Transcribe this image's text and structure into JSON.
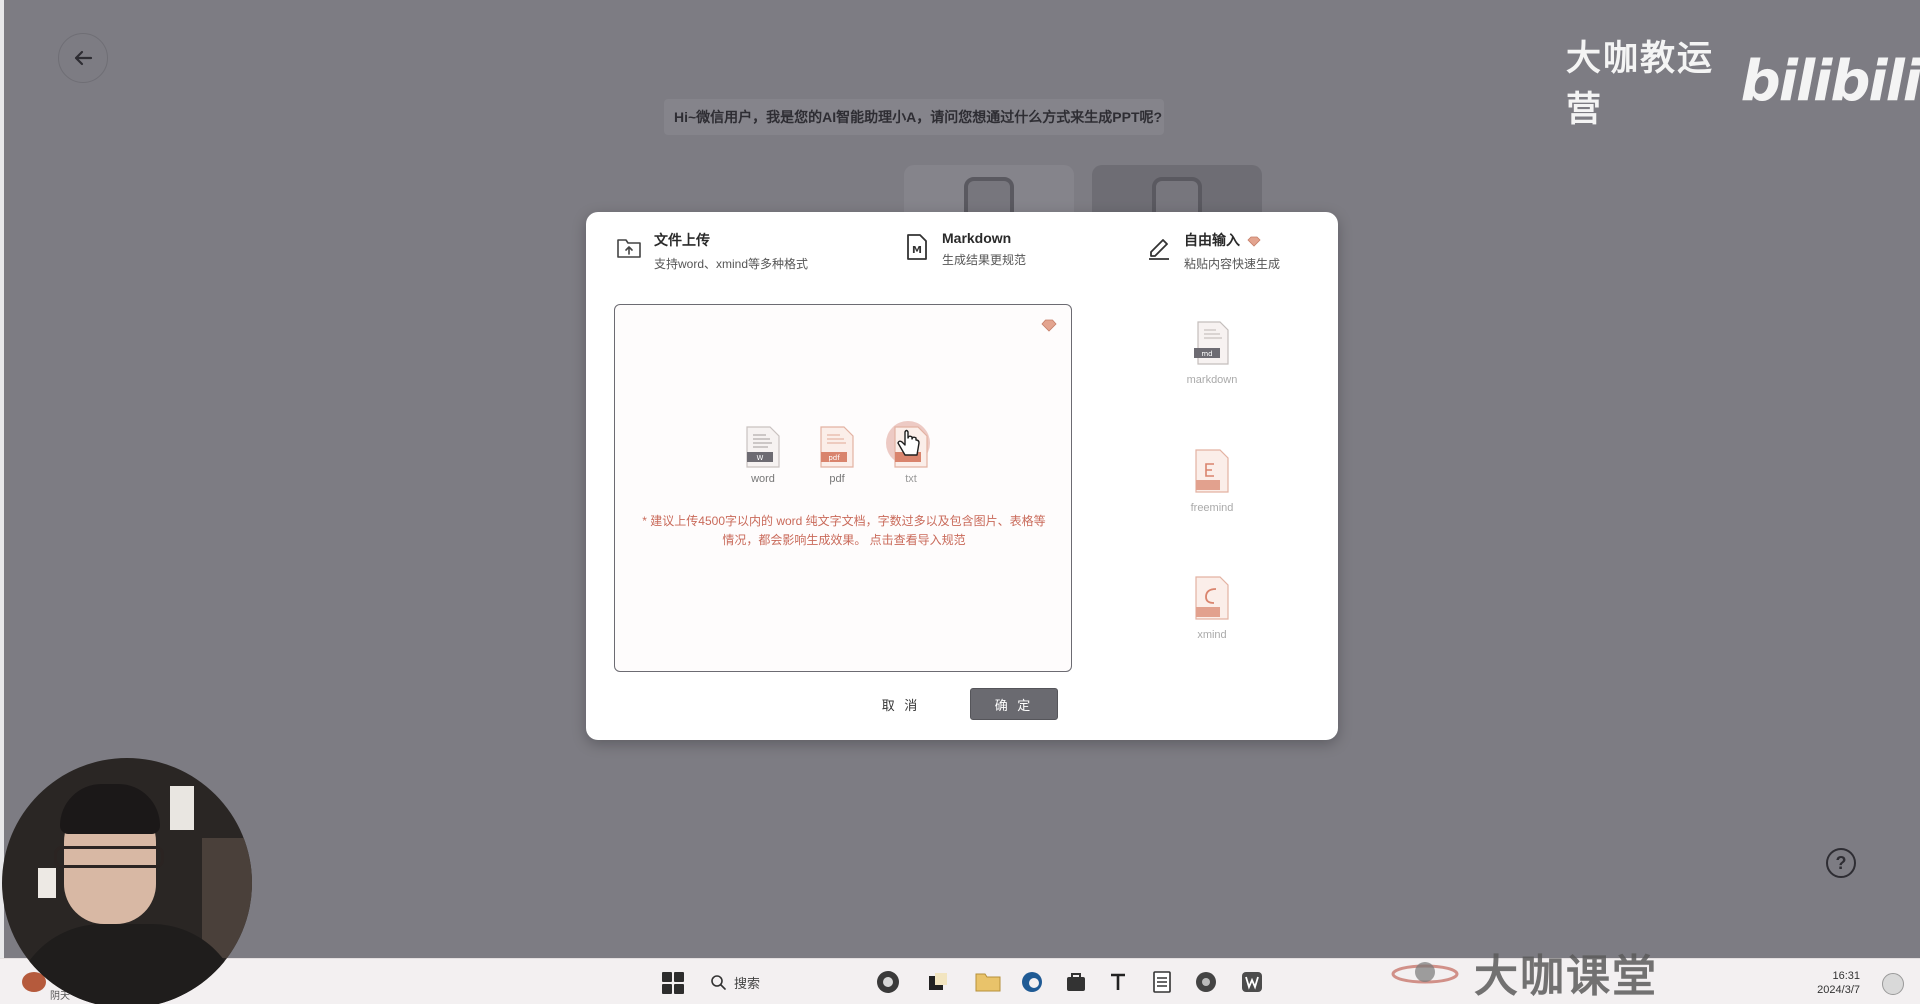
{
  "header": {
    "back_icon": "arrow-left-icon",
    "watermark_text": "大咖教运营",
    "watermark_logo": "bilibili"
  },
  "greeting": "Hi~微信用户，我是您的AI智能助理小A，请问您想通过什么方式来生成PPT呢?",
  "modal": {
    "tabs": [
      {
        "title": "文件上传",
        "desc": "支持word、xmind等多种格式",
        "icon": "folder-upload-icon"
      },
      {
        "title": "Markdown",
        "desc": "生成结果更规范",
        "icon": "markdown-file-icon"
      },
      {
        "title": "自由输入",
        "desc": "粘贴内容快速生成",
        "icon": "pencil-icon",
        "badge": "vip-gem-icon"
      }
    ],
    "upload": {
      "file_types": [
        {
          "label": "word",
          "badge": "W",
          "icon": "word-file-icon"
        },
        {
          "label": "pdf",
          "badge": "pdf",
          "icon": "pdf-file-icon"
        },
        {
          "label": "txt",
          "badge": "txt",
          "icon": "txt-file-icon"
        }
      ],
      "hint_line1": "* 建议上传4500字以内的 word 纯文字文档，字数过多以及包含图片、表格等",
      "hint_line2": "情况，都会影响生成效果。 点击查看导入规范"
    },
    "formats": [
      {
        "label": "markdown",
        "badge": "md",
        "icon": "markdown-format-icon"
      },
      {
        "label": "freemind",
        "badge": "",
        "icon": "freemind-format-icon"
      },
      {
        "label": "xmind",
        "badge": "",
        "icon": "xmind-format-icon"
      }
    ],
    "cancel_label": "取 消",
    "confirm_label": "确 定"
  },
  "help_label": "?",
  "lecture_watermark": "大咖课堂",
  "taskbar": {
    "search_label": "搜索",
    "time": "16:31",
    "date": "2024/3/7",
    "weather_label": "阴天",
    "apps": [
      "browser-icon",
      "app-icon",
      "file-explorer-icon",
      "edge-icon",
      "store-icon",
      "typora-icon",
      "notes-icon",
      "media-icon",
      "wps-icon"
    ]
  },
  "colors": {
    "backdrop": "#7d7c83",
    "modal_bg": "#ffffff",
    "hint_text": "#c96a5a",
    "confirm_bg": "#6a6a70",
    "accent_file": "#d9846d"
  }
}
